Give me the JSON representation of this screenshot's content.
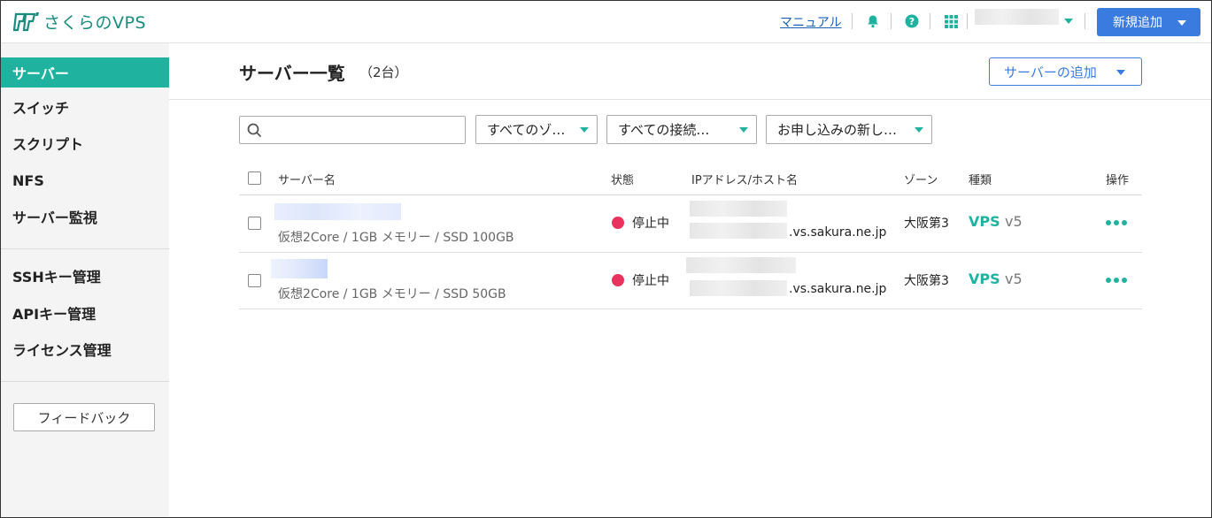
{
  "header": {
    "logo_text": "さくらのVPS",
    "manual_link": "マニュアル",
    "new_button": "新規追加"
  },
  "sidebar": {
    "items": [
      {
        "label": "サーバー"
      },
      {
        "label": "スイッチ"
      },
      {
        "label": "スクリプト"
      },
      {
        "label": "NFS"
      },
      {
        "label": "サーバー監視"
      },
      {
        "label": "SSHキー管理"
      },
      {
        "label": "APIキー管理"
      },
      {
        "label": "ライセンス管理"
      }
    ],
    "feedback_button": "フィードバック"
  },
  "main": {
    "title": "サーバー一覧",
    "count": "（2台）",
    "add_button": "サーバーの追加",
    "filters": {
      "search_placeholder": "",
      "zone": "すべてのゾ…",
      "connection": "すべての接続…",
      "order": "お申し込みの新し…"
    },
    "table": {
      "columns": {
        "name": "サーバー名",
        "status": "状態",
        "ip": "IPアドレス/ホスト名",
        "zone": "ゾーン",
        "type": "種類",
        "action": "操作"
      },
      "rows": [
        {
          "spec": "仮想2Core / 1GB メモリー / SSD 100GB",
          "status": "停止中",
          "host_suffix": ".vs.sakura.ne.jp",
          "zone": "大阪第3",
          "type": "VPS",
          "version": "v5"
        },
        {
          "spec": "仮想2Core / 1GB メモリー / SSD 50GB",
          "status": "停止中",
          "host_suffix": ".vs.sakura.ne.jp",
          "zone": "大阪第3",
          "type": "VPS",
          "version": "v5"
        }
      ]
    }
  },
  "colors": {
    "accent": "#1fb29f",
    "primary": "#3a7be0",
    "status_stopped": "#e8335e"
  },
  "icons": [
    "sakura-logo-icon",
    "bell-icon",
    "help-icon",
    "apps-grid-icon",
    "search-icon",
    "more-icon"
  ]
}
